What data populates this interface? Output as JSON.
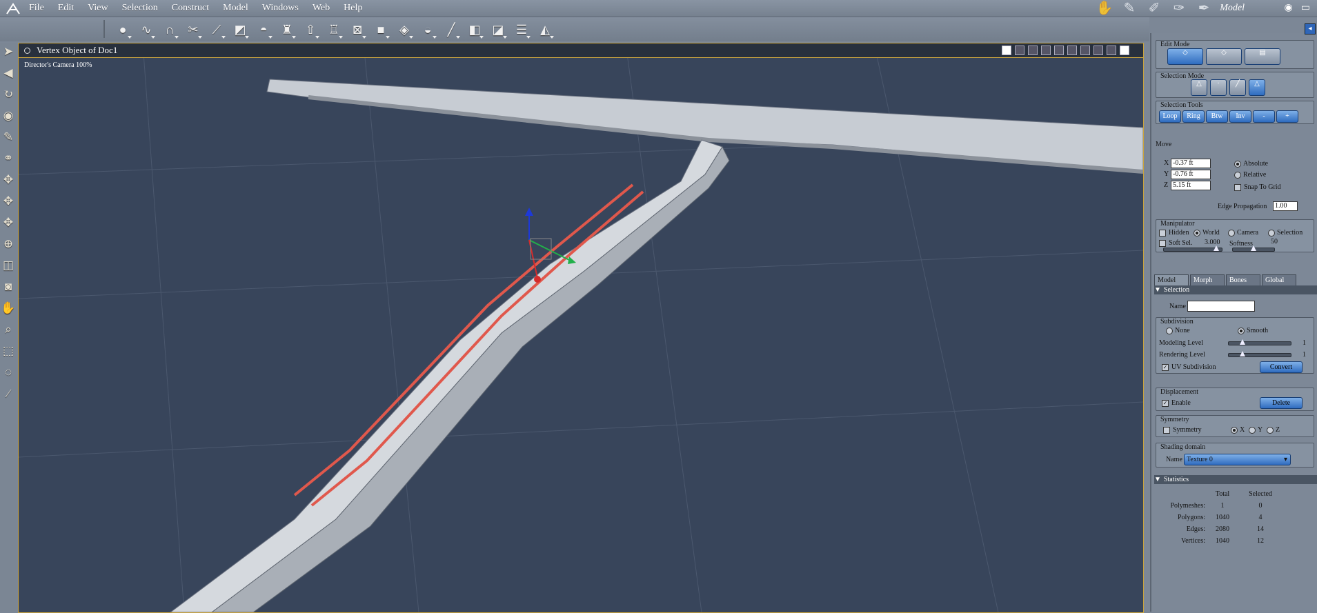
{
  "app": {
    "room_name": "Model"
  },
  "menu": [
    "File",
    "Edit",
    "View",
    "Selection",
    "Construct",
    "Model",
    "Windows",
    "Web",
    "Help"
  ],
  "viewport": {
    "title": "Vertex Object of Doc1",
    "camera_label": "Director's Camera 100%"
  },
  "panel": {
    "edit_mode": {
      "title": "Edit Mode"
    },
    "selection_mode": {
      "title": "Selection Mode"
    },
    "selection_tools": {
      "title": "Selection Tools",
      "buttons": [
        "Loop",
        "Ring",
        "Btw",
        "Inv",
        "-",
        "+"
      ]
    },
    "move": {
      "title": "Move",
      "x_label": "X",
      "x_value": "-0.37 ft",
      "y_label": "Y",
      "y_value": "-0.76 ft",
      "z_label": "Z",
      "z_value": "5.15 ft",
      "absolute": "Absolute",
      "relative": "Relative",
      "snap": "Snap To Grid",
      "edge_prop_label": "Edge Propagation",
      "edge_prop_value": "1.00"
    },
    "manipulator": {
      "title": "Manipulator",
      "hidden": "Hidden",
      "world": "World",
      "camera": "Camera",
      "selection": "Selection",
      "soft_sel": "Soft Sel.",
      "soft_sel_value": "3.000",
      "softness": "Softness",
      "softness_value": "50"
    },
    "tabs": [
      "Model",
      "Morph",
      "Bones",
      "Global"
    ],
    "selection_section": {
      "title": "Selection",
      "name_label": "Name",
      "name_value": ""
    },
    "subdivision": {
      "title": "Subdivision",
      "none": "None",
      "smooth": "Smooth",
      "modeling_level": "Modeling Level",
      "modeling_value": "1",
      "rendering_level": "Rendering Level",
      "rendering_value": "1",
      "uv_subdivision": "UV Subdivision",
      "convert": "Convert"
    },
    "displacement": {
      "title": "Displacement",
      "enable": "Enable",
      "delete": "Delete"
    },
    "symmetry": {
      "title": "Symmetry",
      "symmetry": "Symmetry",
      "x": "X",
      "y": "Y",
      "z": "Z"
    },
    "shading": {
      "title": "Shading domain",
      "name_label": "Name",
      "value": "Texture 0"
    },
    "statistics": {
      "title": "Statistics",
      "col_total": "Total",
      "col_selected": "Selected",
      "rows": [
        {
          "label": "Polymeshes:",
          "total": "1",
          "selected": "0"
        },
        {
          "label": "Polygons:",
          "total": "1040",
          "selected": "4"
        },
        {
          "label": "Edges:",
          "total": "2080",
          "selected": "14"
        },
        {
          "label": "Vertices:",
          "total": "1040",
          "selected": "12"
        }
      ]
    }
  },
  "colors": {
    "viewport_bg": "#38455b",
    "selection": "#e0584c",
    "accent": "#2f6cbf"
  }
}
